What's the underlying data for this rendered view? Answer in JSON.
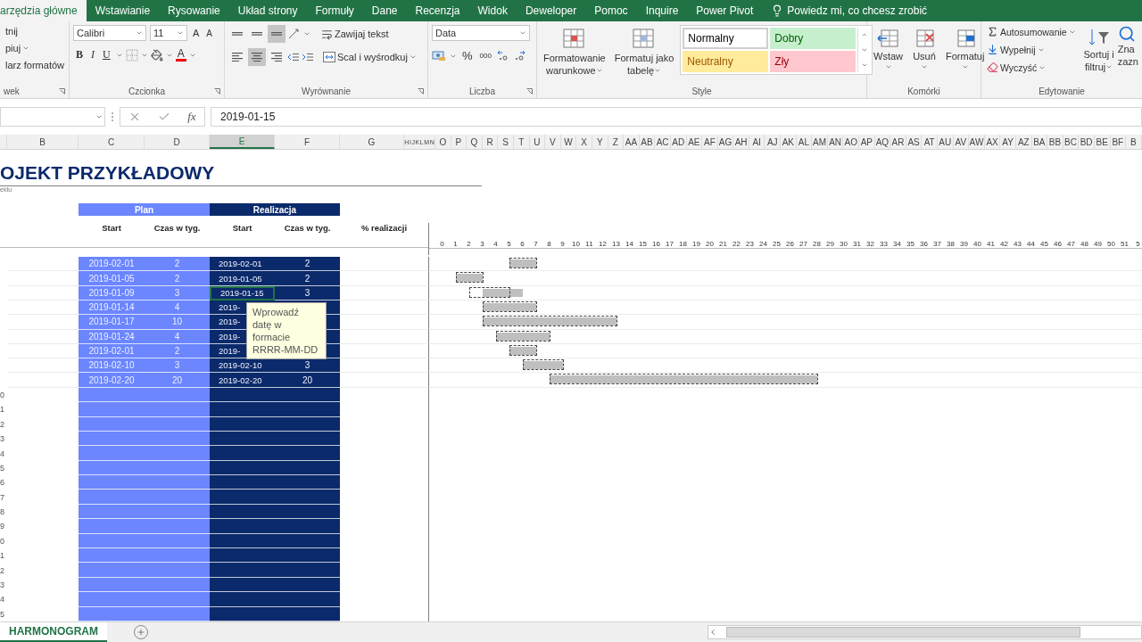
{
  "ribbon_tabs": [
    {
      "label": "arzędzia główne",
      "selected": true
    },
    {
      "label": "Wstawianie",
      "selected": false
    },
    {
      "label": "Rysowanie",
      "selected": false
    },
    {
      "label": "Układ strony",
      "selected": false
    },
    {
      "label": "Formuły",
      "selected": false
    },
    {
      "label": "Dane",
      "selected": false
    },
    {
      "label": "Recenzja",
      "selected": false
    },
    {
      "label": "Widok",
      "selected": false
    },
    {
      "label": "Deweloper",
      "selected": false
    },
    {
      "label": "Pomoc",
      "selected": false
    },
    {
      "label": "Inquire",
      "selected": false
    },
    {
      "label": "Power Pivot",
      "selected": false
    }
  ],
  "tell_me": "Powiedz mi, co chcesz zrobić",
  "clipboard": {
    "items": [
      "tnij",
      "piuj",
      "larz formatów"
    ],
    "label": "wek"
  },
  "font": {
    "family": "Calibri",
    "size": "11",
    "grow": "A",
    "shrink": "A",
    "bold": "B",
    "italic": "I",
    "underline": "U",
    "color_letter": "A",
    "label": "Czcionka"
  },
  "alignment": {
    "vertical": [
      {
        "selected": false
      },
      {
        "selected": false
      },
      {
        "selected": true
      }
    ],
    "horizontal": [
      {
        "selected": false
      },
      {
        "selected": true
      },
      {
        "selected": false
      }
    ],
    "wrap": "Zawijaj tekst",
    "merge": "Scal i wyśrodkuj",
    "label": "Wyrównanie"
  },
  "number": {
    "format": "Data",
    "percent": "%",
    "thousands": "000",
    "label": "Liczba"
  },
  "styles": {
    "buttons": [
      {
        "lines": [
          "Formatowanie",
          "warunkowe"
        ]
      },
      {
        "lines": [
          "Formatuj jako",
          "tabelę"
        ]
      }
    ],
    "gallery": [
      {
        "name": "Normalny",
        "kind": "normal"
      },
      {
        "name": "Dobry",
        "kind": "good"
      },
      {
        "name": "Neutralny",
        "kind": "neutral"
      },
      {
        "name": "Zły",
        "kind": "bad"
      }
    ],
    "label": "Style"
  },
  "cells": {
    "buttons": [
      "Wstaw",
      "Usuń",
      "Formatuj"
    ],
    "label": "Komórki"
  },
  "editing": {
    "items": [
      "Autosumowanie",
      "Wypełnij",
      "Wyczyść"
    ],
    "sort": [
      "Sortuj i",
      "filtruj"
    ],
    "find": [
      "Zna",
      "zazn"
    ],
    "label": "Edytowanie"
  },
  "formula_bar": {
    "fx": "fx",
    "value": "2019-01-15"
  },
  "columns": {
    "main": [
      {
        "label": "B",
        "selected": false
      },
      {
        "label": "C",
        "selected": false
      },
      {
        "label": "D",
        "selected": false
      },
      {
        "label": "E",
        "selected": true
      },
      {
        "label": "F",
        "selected": false
      },
      {
        "label": "G",
        "selected": false
      }
    ],
    "narrow": [
      "H",
      "I",
      "J",
      "K",
      "L",
      "M",
      "N"
    ],
    "weeks": [
      "O",
      "P",
      "Q",
      "R",
      "S",
      "T",
      "U",
      "V",
      "W",
      "X",
      "Y",
      "Z",
      "AA",
      "AB",
      "AC",
      "AD",
      "AE",
      "AF",
      "AG",
      "AH",
      "AI",
      "AJ",
      "AK",
      "AL",
      "AM",
      "AN",
      "AO",
      "AP",
      "AQ",
      "AR",
      "AS",
      "AT",
      "AU",
      "AV",
      "AW",
      "AX",
      "AY",
      "AZ",
      "BA",
      "BB",
      "BC",
      "BD",
      "BE",
      "BF",
      "B"
    ]
  },
  "sheet": {
    "title": "OJEKT PRZYKŁADOWY",
    "subtitle": "ektu",
    "groups": [
      "Plan",
      "Realizacja"
    ],
    "headers": [
      "Start",
      "Czas w tyg.",
      "Start",
      "Czas w tyg.",
      "% realizacji"
    ],
    "weeks": [
      "0",
      "1",
      "2",
      "3",
      "4",
      "5",
      "6",
      "7",
      "8",
      "9",
      "10",
      "11",
      "12",
      "13",
      "14",
      "15",
      "16",
      "17",
      "18",
      "19",
      "20",
      "21",
      "22",
      "23",
      "24",
      "25",
      "26",
      "27",
      "28",
      "29",
      "30",
      "31",
      "32",
      "33",
      "34",
      "35",
      "36",
      "37",
      "38",
      "39",
      "40",
      "41",
      "42",
      "43",
      "44",
      "45",
      "46",
      "47",
      "48",
      "49",
      "50",
      "51",
      "5"
    ],
    "tasks": [
      {
        "plan_start": "2019-02-01",
        "plan_weeks": "2",
        "real_start": "2019-02-01",
        "real_weeks": "2",
        "selected": false
      },
      {
        "plan_start": "2019-01-05",
        "plan_weeks": "2",
        "real_start": "2019-01-05",
        "real_weeks": "2",
        "selected": false
      },
      {
        "plan_start": "2019-01-09",
        "plan_weeks": "3",
        "real_start": "2019-01-15",
        "real_weeks": "3",
        "selected": true
      },
      {
        "plan_start": "2019-01-14",
        "plan_weeks": "4",
        "real_start": "2019-",
        "selected": false
      },
      {
        "plan_start": "2019-01-17",
        "plan_weeks": "10",
        "real_start": "2019-",
        "selected": false
      },
      {
        "plan_start": "2019-01-24",
        "plan_weeks": "4",
        "real_start": "2019-",
        "selected": false
      },
      {
        "plan_start": "2019-02-01",
        "plan_weeks": "2",
        "real_start": "2019-",
        "selected": false
      },
      {
        "plan_start": "2019-02-10",
        "plan_weeks": "3",
        "real_start": "2019-02-10",
        "real_weeks": "3",
        "selected": false
      },
      {
        "plan_start": "2019-02-20",
        "plan_weeks": "20",
        "real_start": "2019-02-20",
        "real_weeks": "20",
        "selected": false
      }
    ],
    "empty_rows": [
      "0",
      "1",
      "2",
      "3",
      "4",
      "5",
      "6",
      "7",
      "8",
      "9",
      "0",
      "1",
      "2",
      "3",
      "4",
      "5"
    ]
  },
  "tooltip": "Wprowadź datę w formacie RRRR-MM-DD",
  "sheet_tabs": [
    {
      "label": "HARMONOGRAM",
      "selected": true
    }
  ]
}
